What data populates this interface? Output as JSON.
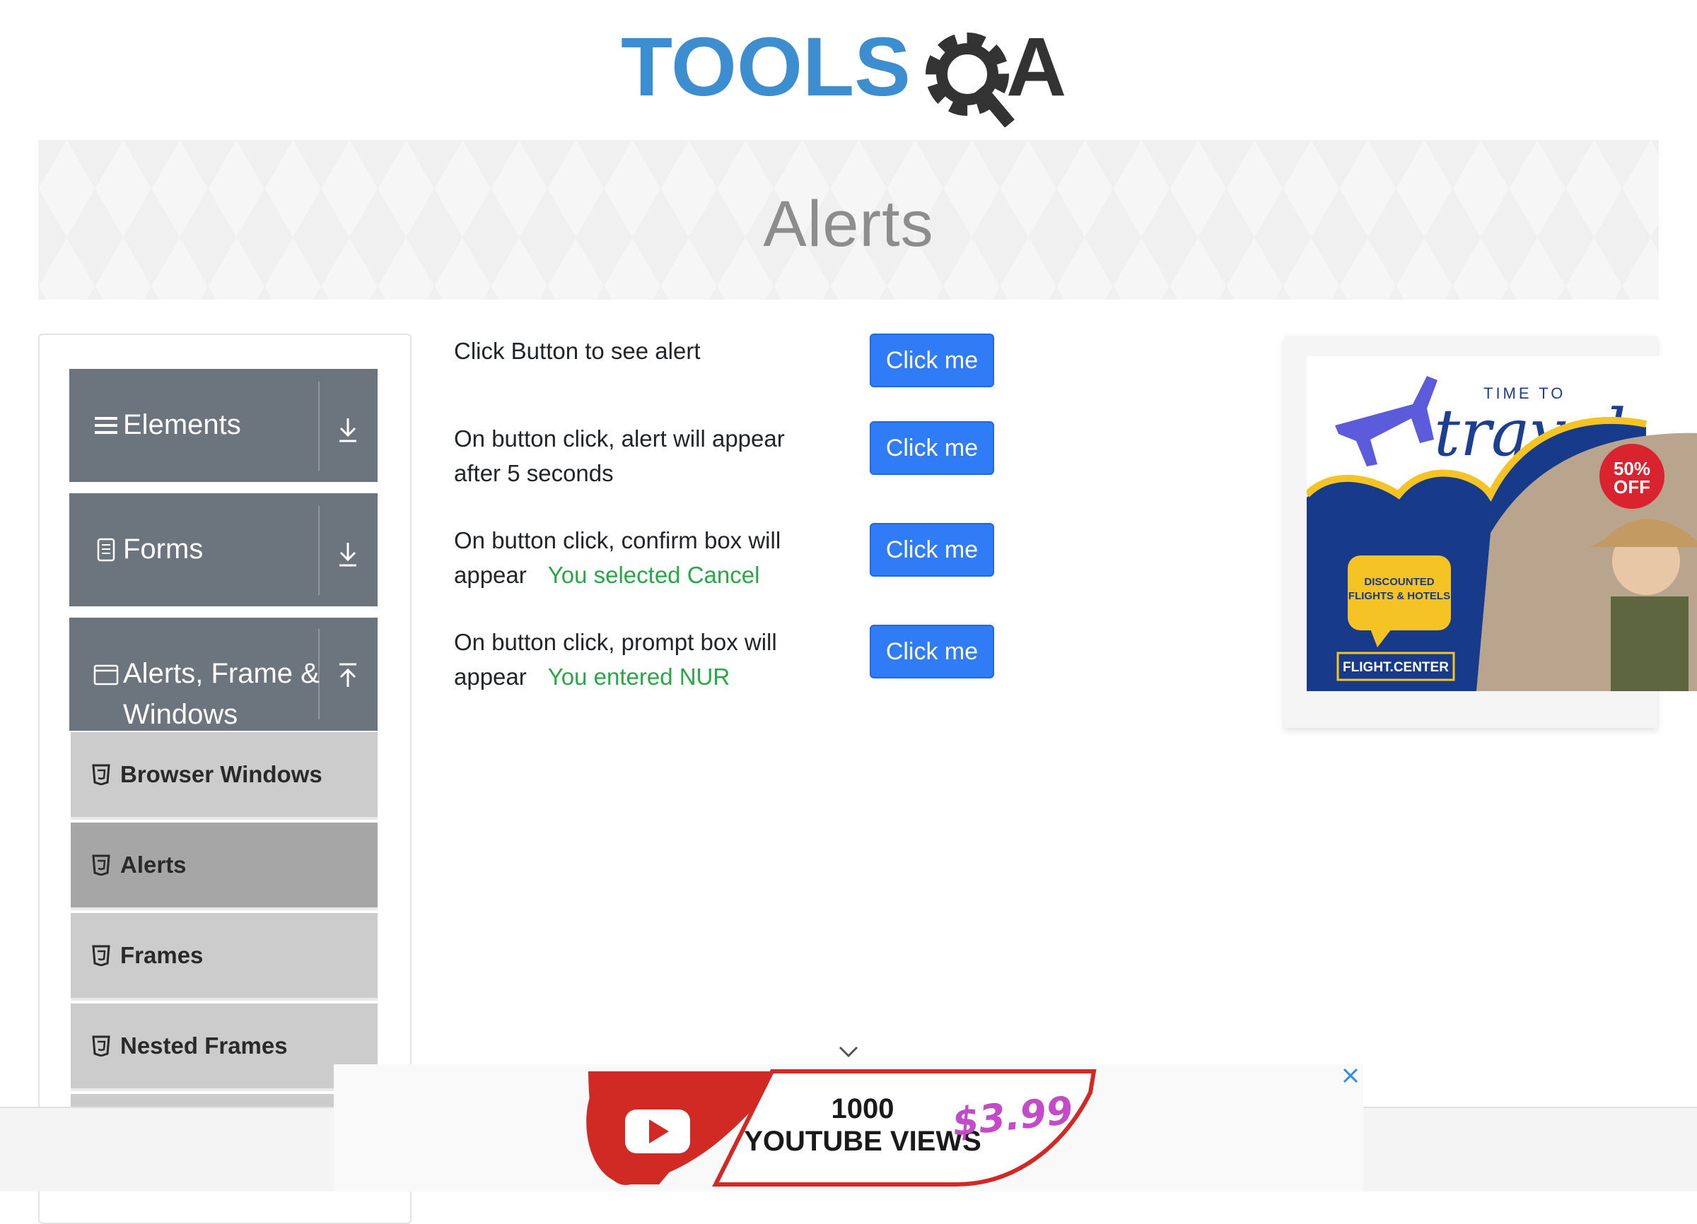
{
  "header": {
    "logo_text_left": "TOOLS",
    "logo_text_right": "A",
    "logo_color_blue": "#3d8ed1",
    "logo_color_dark": "#333333"
  },
  "page": {
    "title": "Alerts"
  },
  "sidebar": {
    "groups": [
      {
        "label": "Elements",
        "icon": "hamburger-icon",
        "arrow": "download-arrow-icon"
      },
      {
        "label": "Forms",
        "icon": "document-icon",
        "arrow": "download-arrow-icon"
      },
      {
        "label_line1": "Alerts, Frame &",
        "label_line2": "Windows",
        "icon": "window-icon",
        "arrow": "upload-arrow-icon"
      }
    ],
    "items": [
      {
        "label": "Browser Windows",
        "icon": "html5-icon",
        "active": false
      },
      {
        "label": "Alerts",
        "icon": "html5-icon",
        "active": true
      },
      {
        "label": "Frames",
        "icon": "html5-icon",
        "active": false
      },
      {
        "label": "Nested Frames",
        "icon": "html5-icon",
        "active": false
      }
    ],
    "header_color": "#6c757d",
    "item_color": "#cccccc",
    "active_item_color": "#a6a6a6"
  },
  "main": {
    "rows": [
      {
        "line1": "Click Button to see alert",
        "line2": "",
        "result": "",
        "button": "Click me"
      },
      {
        "line1": "On button click, alert will appear",
        "line2": "after 5 seconds",
        "result": "",
        "button": "Click me"
      },
      {
        "line1": "On button click, confirm box will",
        "line2": "appear",
        "result": "You selected Cancel",
        "button": "Click me"
      },
      {
        "line1": "On button click, prompt box will",
        "line2": "appear",
        "result": "You entered NUR",
        "button": "Click me"
      }
    ],
    "button_color": "#2f7cf6",
    "result_color": "#28a745"
  },
  "ad_right": {
    "time_to": "TIME TO",
    "travel": "travel",
    "badge_line1": "50%",
    "badge_line2": "OFF",
    "bubble_line1": "DISCOUNTED",
    "bubble_line2": "FLIGHTS & HOTELS",
    "brand": "FLIGHT.CENTER"
  },
  "ad_bottom": {
    "line1": "1000",
    "line2": "YOUTUBE VIEWS",
    "price": "$3.99"
  }
}
